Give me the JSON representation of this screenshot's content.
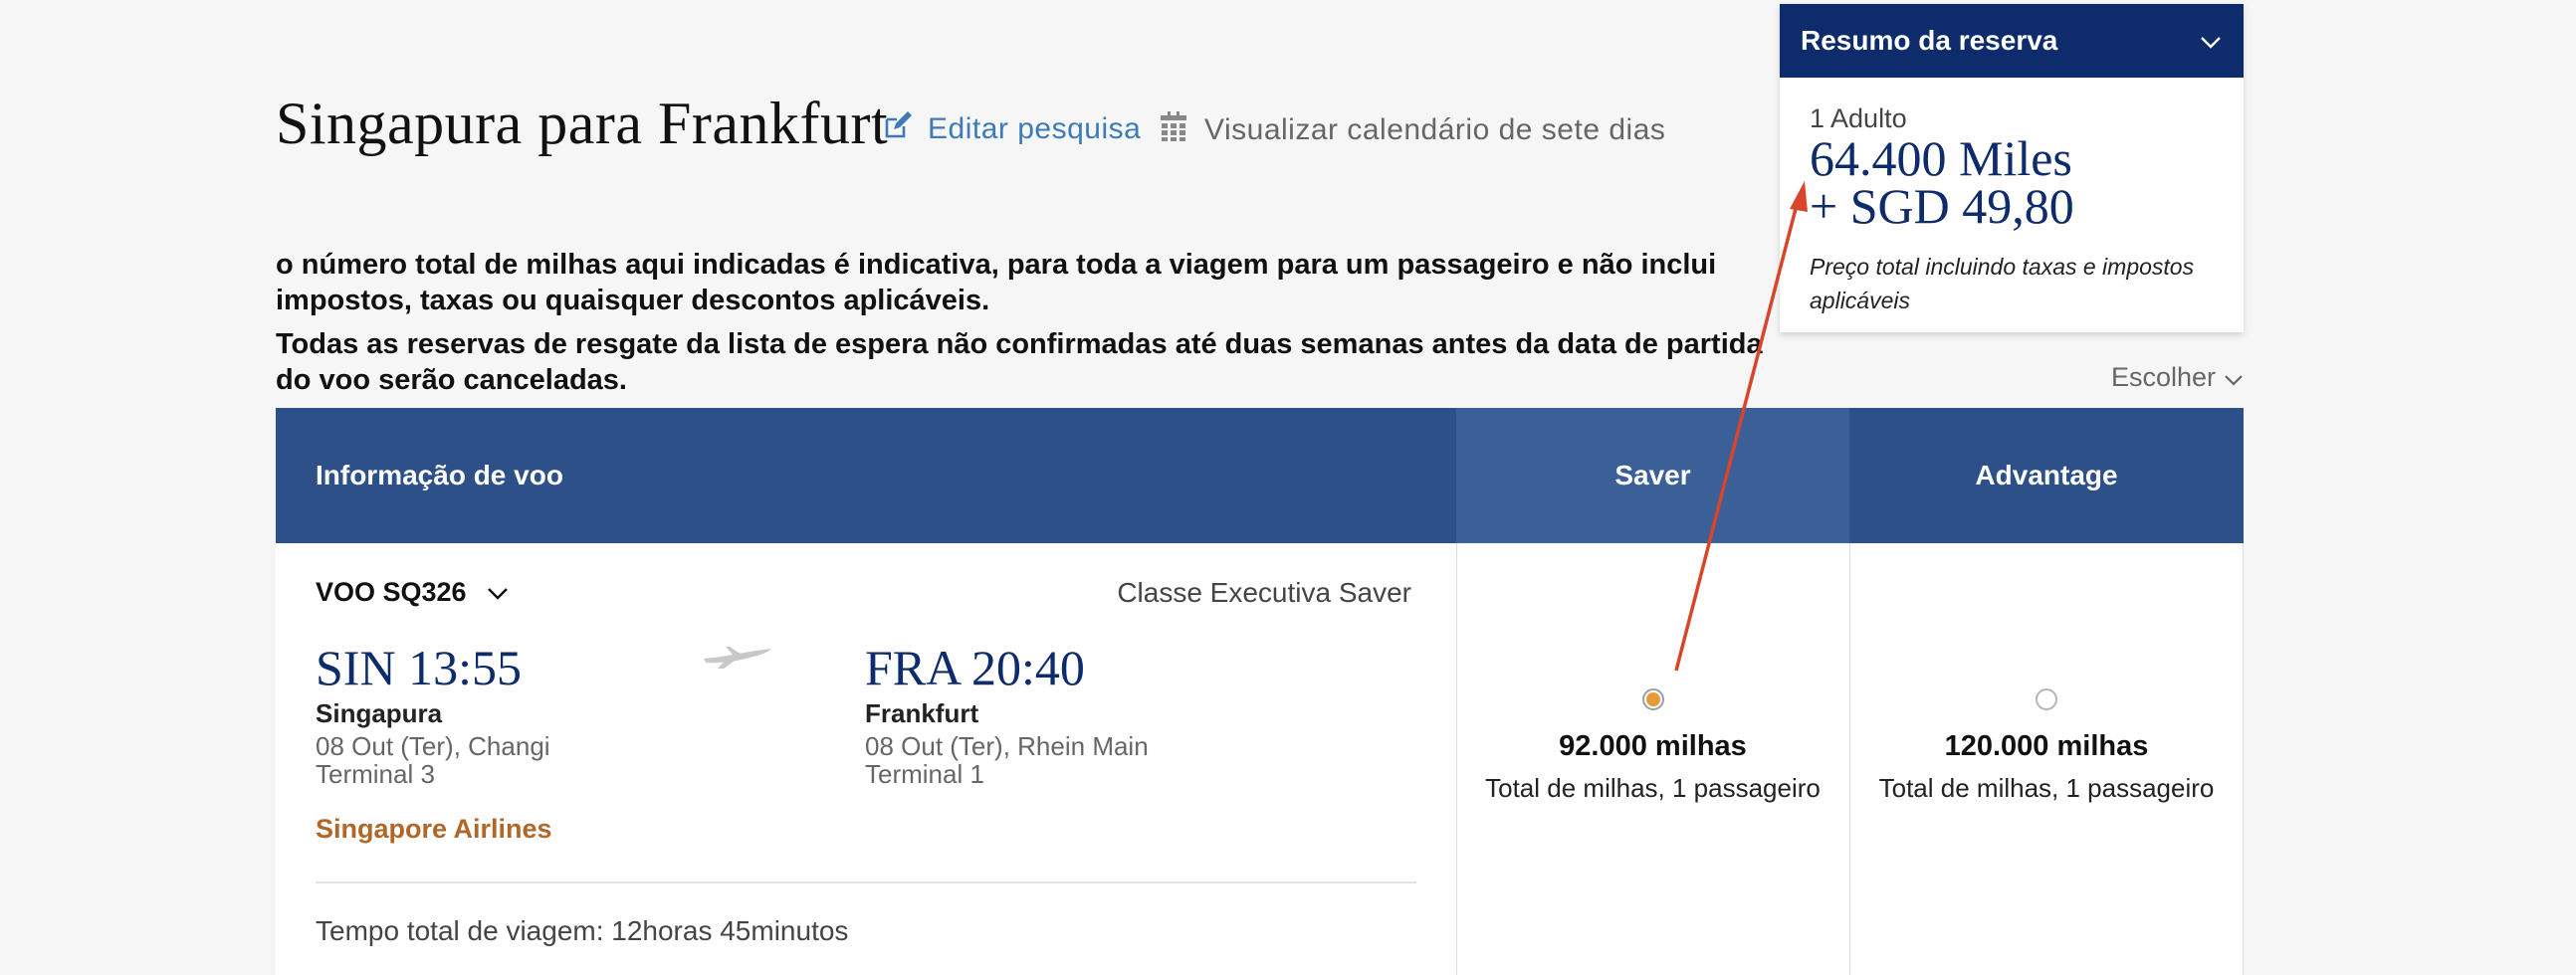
{
  "header": {
    "title": "Singapura para Frankfurt",
    "edit_search": "Editar pesquisa",
    "calendar_link": "Visualizar calendário de sete dias"
  },
  "notices": [
    "o número total de milhas aqui indicadas é indicativa, para toda a viagem para um passageiro e não inclui impostos, taxas ou quaisquer descontos aplicáveis.",
    "Todas as reservas de resgate da lista de espera não confirmadas até duas semanas antes da data de partida do voo serão canceladas."
  ],
  "summary": {
    "title": "Resumo da reserva",
    "passengers": "1 Adulto",
    "miles": "64.400 Miles",
    "cash": "+ SGD 49,80",
    "note": "Preço total incluindo taxas e impostos aplicáveis"
  },
  "choose_label": "Escolher",
  "table": {
    "headers": {
      "info": "Informação de voo",
      "saver": "Saver",
      "advantage": "Advantage"
    },
    "flight": {
      "number": "VOO SQ326",
      "fare_class": "Classe Executiva Saver",
      "departure": {
        "time": "SIN 13:55",
        "city": "Singapura",
        "date_airport": "08 Out (Ter), Changi",
        "terminal": "Terminal 3"
      },
      "arrival": {
        "time": "FRA 20:40",
        "city": "Frankfurt",
        "date_airport": "08 Out (Ter), Rhein Main",
        "terminal": "Terminal 1"
      },
      "airline": "Singapore Airlines",
      "duration": "Tempo total de viagem: 12horas 45minutos"
    },
    "fares": {
      "saver": {
        "miles": "92.000 milhas",
        "sub": "Total de milhas, 1 passageiro",
        "selected": true
      },
      "advantage": {
        "miles": "120.000 milhas",
        "sub": "Total de milhas, 1 passageiro",
        "selected": false
      }
    }
  },
  "colors": {
    "navy": "#0e2b6b",
    "table_header": "#2d5088",
    "saver_header": "#3b6097",
    "link_blue": "#3d7ab8",
    "airline_orange": "#b0672a",
    "radio_selected": "#e89a38",
    "annotation_arrow": "#d9452b"
  },
  "icons": {
    "edit": "edit-icon",
    "calendar": "calendar-icon",
    "chevron": "chevron-down-icon",
    "plane": "plane-icon"
  }
}
